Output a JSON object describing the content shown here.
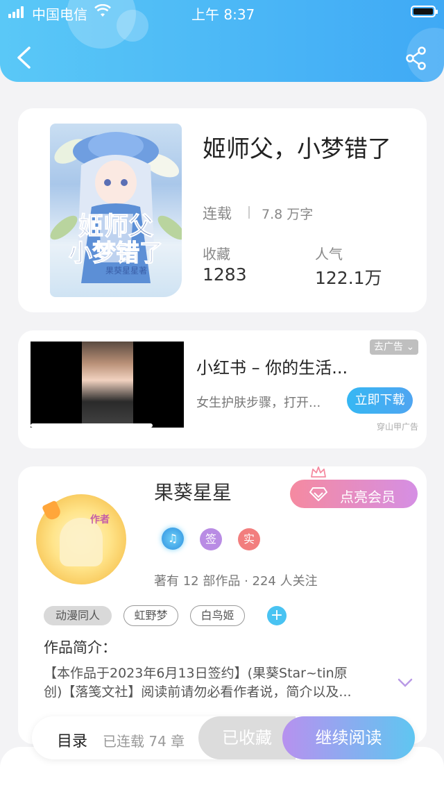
{
  "status_bar": {
    "carrier": "中国电信",
    "time": "上午 8:37"
  },
  "header": {
    "back_icon": "back-chevron-icon",
    "share_icon": "share-icon"
  },
  "book": {
    "title": "姬师父，小梦错了",
    "status": "连载",
    "word_count": "7.8 万字",
    "favorites_label": "收藏",
    "favorites_value": "1283",
    "popularity_label": "人气",
    "popularity_value": "122.1万",
    "cover_title": "姬师父，小梦错了",
    "cover_author": "果葵星星著"
  },
  "ad": {
    "tag": "去广告",
    "title": "小红书 – 你的生活...",
    "desc": "女生护肤步骤，打开...",
    "button": "立即下载",
    "source": "穿山甲广告"
  },
  "author": {
    "name": "果葵星星",
    "avatar_tag": "作者",
    "vip_button": "点亮会员",
    "badges": [
      "♫",
      "签",
      "实"
    ],
    "works_info": "著有 12 部作品 · 224 人关注",
    "tags": [
      "动漫同人",
      "虹野梦",
      "白鸟姬"
    ],
    "intro_label": "作品简介：",
    "intro_line1": "【本作品于2023年6月13日签约】(果葵Star~tin原",
    "intro_line2": "创)【落笺文社】阅读前请勿必看作者说，简介以及..."
  },
  "bottom": {
    "catalog": "目录",
    "chapters": "已连载 74 章",
    "collected": "已收藏",
    "continue": "继续阅读"
  },
  "colors": {
    "header_blue": "#3fa9f5",
    "download_blue": "#36b7f3",
    "vip_pink": "#f58aa0",
    "read_gradient_start": "#b791ef",
    "read_gradient_end": "#5fc6f1"
  }
}
